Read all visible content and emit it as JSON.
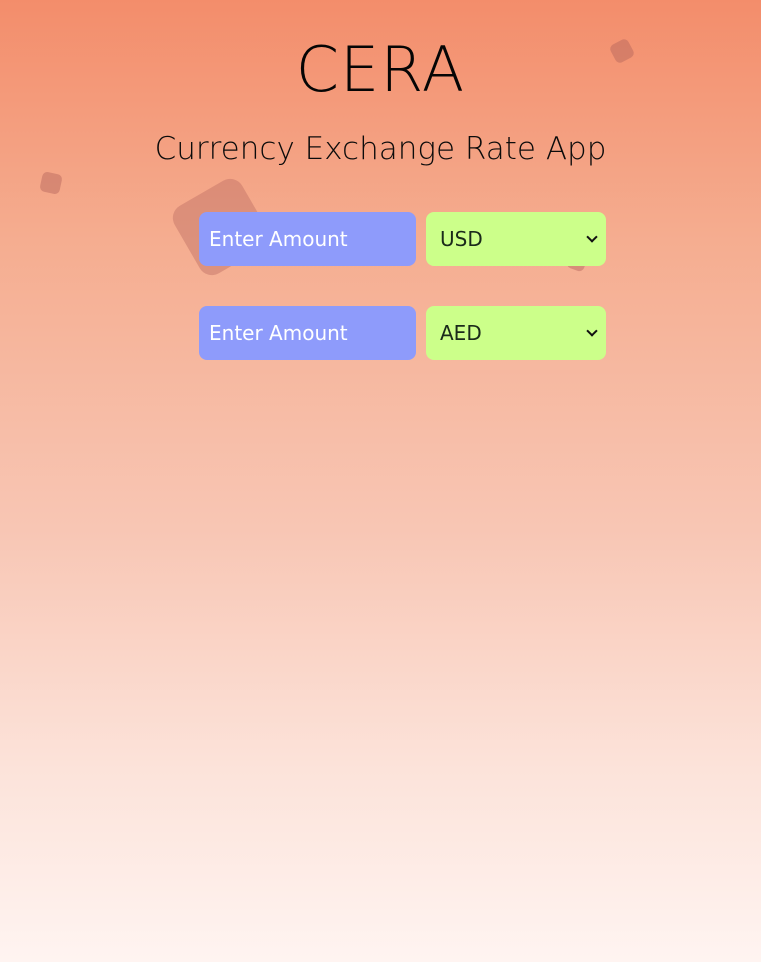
{
  "app": {
    "title": "CERA",
    "subtitle": "Currency Exchange Rate App"
  },
  "converter": {
    "rows": [
      {
        "amount_value": "",
        "amount_placeholder": "Enter Amount",
        "currency": "USD"
      },
      {
        "amount_value": "",
        "amount_placeholder": "Enter Amount",
        "currency": "AED"
      }
    ]
  },
  "colors": {
    "amount_field": "#8e9bfb",
    "currency_select": "#ccff8a",
    "background_top": "#f38d6b",
    "background_bottom": "#fff4f1"
  },
  "icons": {
    "select_arrow": "chevron-down-icon"
  }
}
